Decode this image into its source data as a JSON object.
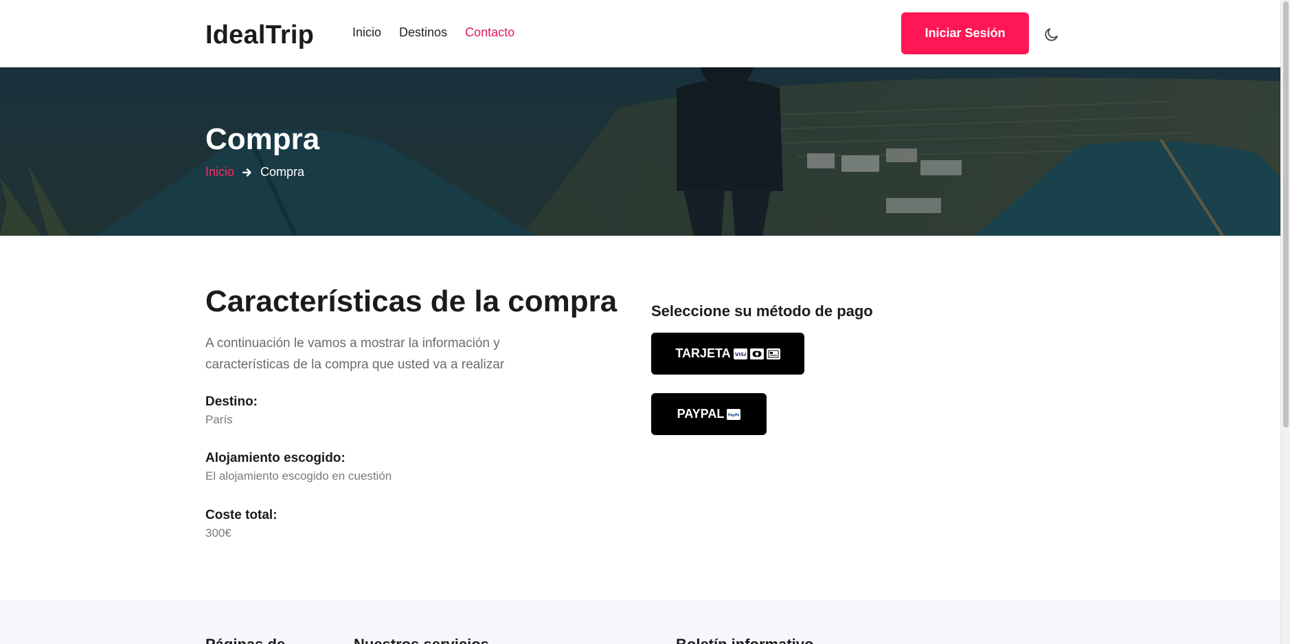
{
  "header": {
    "logo": "IdealTrip",
    "nav": [
      "Inicio",
      "Destinos",
      "Contacto"
    ],
    "active_nav": "Contacto",
    "login_label": "Iniciar Sesión",
    "theme_icon": "moon-icon"
  },
  "hero": {
    "title": "Compra",
    "breadcrumb": {
      "link": "Inicio",
      "separator_icon": "arrow-right-icon",
      "current": "Compra"
    }
  },
  "main": {
    "title": "Características de la compra",
    "description": "A continuación le vamos a mostrar la información y características de la compra que usted va a realizar",
    "details": [
      {
        "label": "Destino:",
        "value": "París"
      },
      {
        "label": "Alojamiento escogido:",
        "value": "El alojamiento escogido en cuestión"
      },
      {
        "label": "Coste total:",
        "value": "300€"
      }
    ]
  },
  "payment": {
    "title": "Seleccione su método de pago",
    "card_label": "TARJETA",
    "card_icons": [
      "visa-icon",
      "mastercard-icon",
      "generic-card-icon"
    ],
    "paypal_label": "PAYPAL",
    "paypal_icon": "paypal-icon"
  },
  "footer": {
    "headings": [
      "Páginas de...",
      "Nuestros servicios",
      "Boletín informativo"
    ]
  },
  "colors": {
    "accent": "#ff1654",
    "link": "#e4185b",
    "pay_button": "#000000",
    "footer_bg": "#f7f6fd"
  }
}
